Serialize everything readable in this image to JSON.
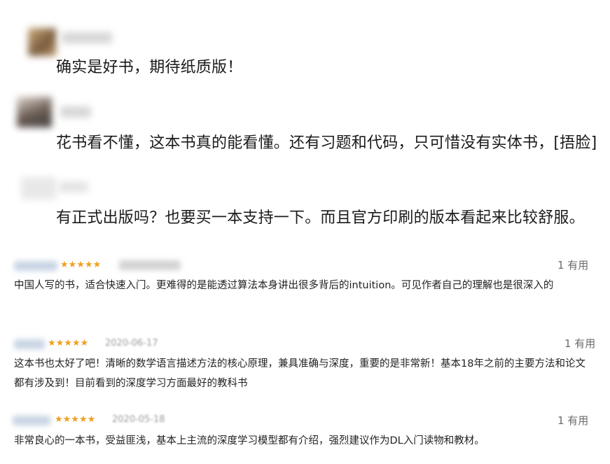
{
  "comments": [
    {
      "text": "确实是好书，期待纸质版！"
    },
    {
      "text": "花书看不懂，这本书真的能看懂。还有习题和代码，只可惜没有实体书，[捂脸]"
    },
    {
      "text": "有正式出版吗？也要买一本支持一下。而且官方印刷的版本看起来比较舒服。"
    }
  ],
  "reviews": [
    {
      "stars": "★★★★★",
      "date": "",
      "helpful": "1 有用",
      "text": "中国人写的书，适合快速入门。更难得的是能透过算法本身讲出很多背后的intuition。可见作者自己的理解也是很深入的"
    },
    {
      "stars": "★★★★★",
      "date": "2020-06-17",
      "helpful": "1 有用",
      "text": "这本书也太好了吧！清晰的数学语言描述方法的核心原理，兼具准确与深度，重要的是非常新！基本18年之前的主要方法和论文都有涉及到！目前看到的深度学习方面最好的教科书"
    },
    {
      "stars": "★★★★★",
      "date": "2020-05-18",
      "helpful": "1 有用",
      "text": "非常良心的一本书，受益匪浅，基本上主流的深度学习模型都有介绍，强烈建议作为DL入门读物和教材。"
    }
  ]
}
